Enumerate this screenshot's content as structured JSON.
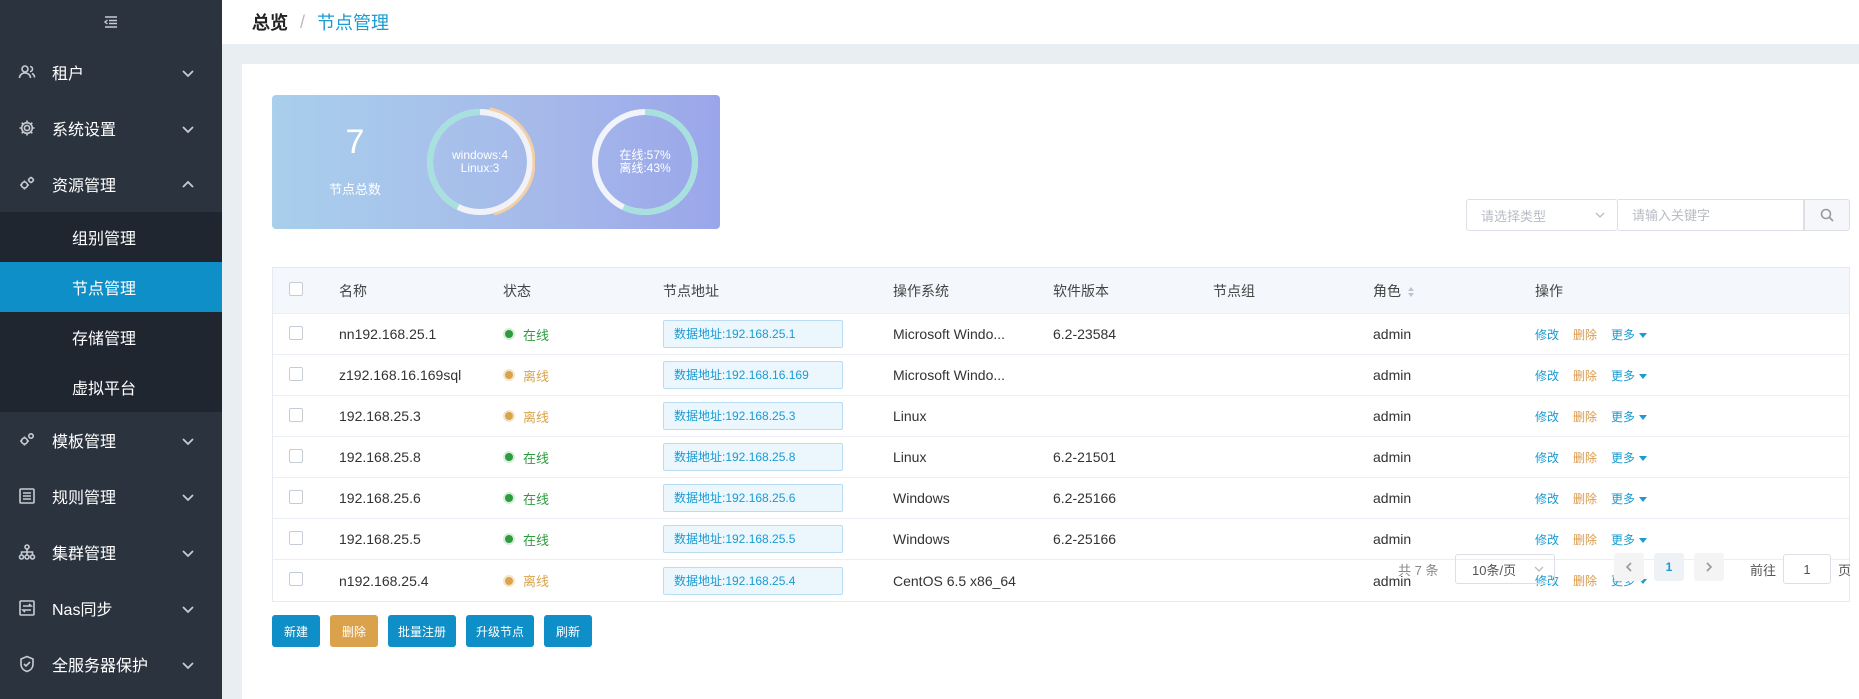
{
  "sidebar": {
    "items": [
      {
        "label": "租户",
        "icon": "user-group-icon"
      },
      {
        "label": "系统设置",
        "icon": "gear-icon"
      },
      {
        "label": "资源管理",
        "icon": "gears-icon",
        "expanded": true,
        "children": [
          {
            "label": "组别管理"
          },
          {
            "label": "节点管理",
            "active": true
          },
          {
            "label": "存储管理"
          },
          {
            "label": "虚拟平台"
          }
        ]
      },
      {
        "label": "模板管理",
        "icon": "gears-icon"
      },
      {
        "label": "规则管理",
        "icon": "list-icon"
      },
      {
        "label": "集群管理",
        "icon": "cluster-icon"
      },
      {
        "label": "Nas同步",
        "icon": "sync-icon"
      },
      {
        "label": "全服务器保护",
        "icon": "shield-icon"
      }
    ]
  },
  "breadcrumb": {
    "home": "总览",
    "separator": "/",
    "current": "节点管理"
  },
  "stats": {
    "total": "7",
    "total_label": "节点总数",
    "os_donut": {
      "line1": "windows:4",
      "line2": "Linux:3",
      "windows": 4,
      "linux": 3
    },
    "status_donut": {
      "line1": "在线:57%",
      "line2": "离线:43%",
      "online_pct": 57,
      "offline_pct": 43
    }
  },
  "search": {
    "type_placeholder": "请选择类型",
    "keyword_placeholder": "请输入关键字"
  },
  "table": {
    "headers": {
      "name": "名称",
      "status": "状态",
      "addr": "节点地址",
      "os": "操作系统",
      "version": "软件版本",
      "group": "节点组",
      "role": "角色",
      "op": "操作"
    },
    "rows": [
      {
        "name": "nn192.168.25.1",
        "status": "在线",
        "online": true,
        "addr": "数据地址:192.168.25.1",
        "os": "Microsoft Windo...",
        "version": "6.2-23584",
        "group": "",
        "role": "admin"
      },
      {
        "name": "z192.168.16.169sql",
        "status": "离线",
        "online": false,
        "addr": "数据地址:192.168.16.169",
        "os": "Microsoft Windo...",
        "version": "",
        "group": "",
        "role": "admin"
      },
      {
        "name": "192.168.25.3",
        "status": "离线",
        "online": false,
        "addr": "数据地址:192.168.25.3",
        "os": "Linux",
        "version": "",
        "group": "",
        "role": "admin"
      },
      {
        "name": "192.168.25.8",
        "status": "在线",
        "online": true,
        "addr": "数据地址:192.168.25.8",
        "os": "Linux",
        "version": "6.2-21501",
        "group": "",
        "role": "admin"
      },
      {
        "name": "192.168.25.6",
        "status": "在线",
        "online": true,
        "addr": "数据地址:192.168.25.6",
        "os": "Windows",
        "version": "6.2-25166",
        "group": "",
        "role": "admin"
      },
      {
        "name": "192.168.25.5",
        "status": "在线",
        "online": true,
        "addr": "数据地址:192.168.25.5",
        "os": "Windows",
        "version": "6.2-25166",
        "group": "",
        "role": "admin"
      },
      {
        "name": "n192.168.25.4",
        "status": "离线",
        "online": false,
        "addr": "数据地址:192.168.25.4",
        "os": "CentOS 6.5 x86_64",
        "version": "",
        "group": "",
        "role": "admin"
      }
    ],
    "actions": {
      "edit": "修改",
      "delete": "删除",
      "more": "更多"
    }
  },
  "buttons": {
    "new": "新建",
    "delete": "删除",
    "batch_register": "批量注册",
    "upgrade": "升级节点",
    "refresh": "刷新"
  },
  "pagination": {
    "total": "共 7 条",
    "page_size": "10条/页",
    "current_page": "1",
    "goto_label": "前往",
    "goto_value": "1",
    "goto_suffix": "页"
  },
  "colors": {
    "sidebar_bg": "#2b333e",
    "active": "#0e8fc7",
    "online": "#2e9b3e",
    "offline": "#d9a44a",
    "link": "#1a9bd1"
  }
}
